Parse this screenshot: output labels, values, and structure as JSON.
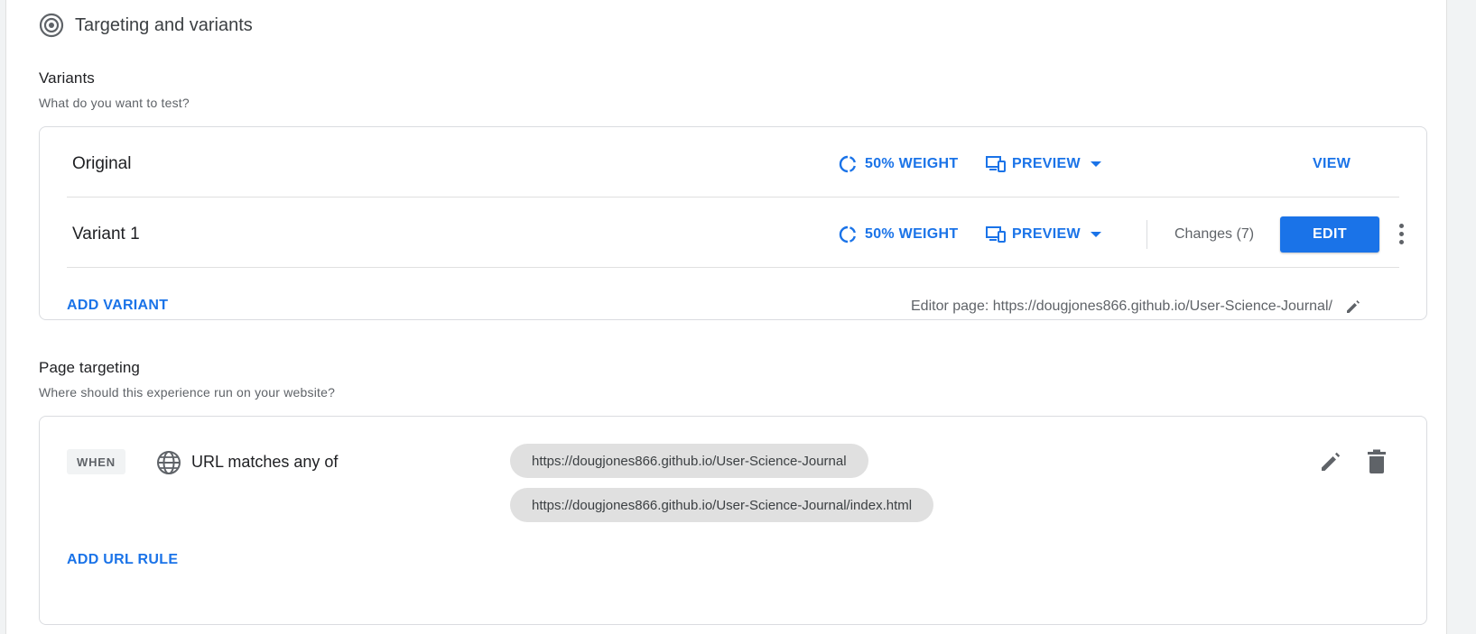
{
  "section": {
    "title": "Targeting and variants",
    "icon": "target-icon"
  },
  "variants": {
    "heading": "Variants",
    "subheading": "What do you want to test?",
    "rows": [
      {
        "name": "Original",
        "weight": "50% WEIGHT",
        "preview": "PREVIEW",
        "action": "VIEW"
      },
      {
        "name": "Variant 1",
        "weight": "50% WEIGHT",
        "preview": "PREVIEW",
        "changes": "Changes (7)",
        "action": "EDIT"
      }
    ],
    "add_label": "ADD VARIANT",
    "editor_page": "Editor page: https://dougjones866.github.io/User-Science-Journal/"
  },
  "targeting": {
    "heading": "Page targeting",
    "subheading": "Where should this experience run on your website?",
    "when_label": "WHEN",
    "condition": "URL matches any of",
    "urls": [
      "https://dougjones866.github.io/User-Science-Journal",
      "https://dougjones866.github.io/User-Science-Journal/index.html"
    ],
    "add_rule_label": "ADD URL RULE"
  },
  "colors": {
    "accent": "#1a73e8",
    "icon_gray": "#5f6368",
    "chip_bg": "#e0e0e0"
  }
}
